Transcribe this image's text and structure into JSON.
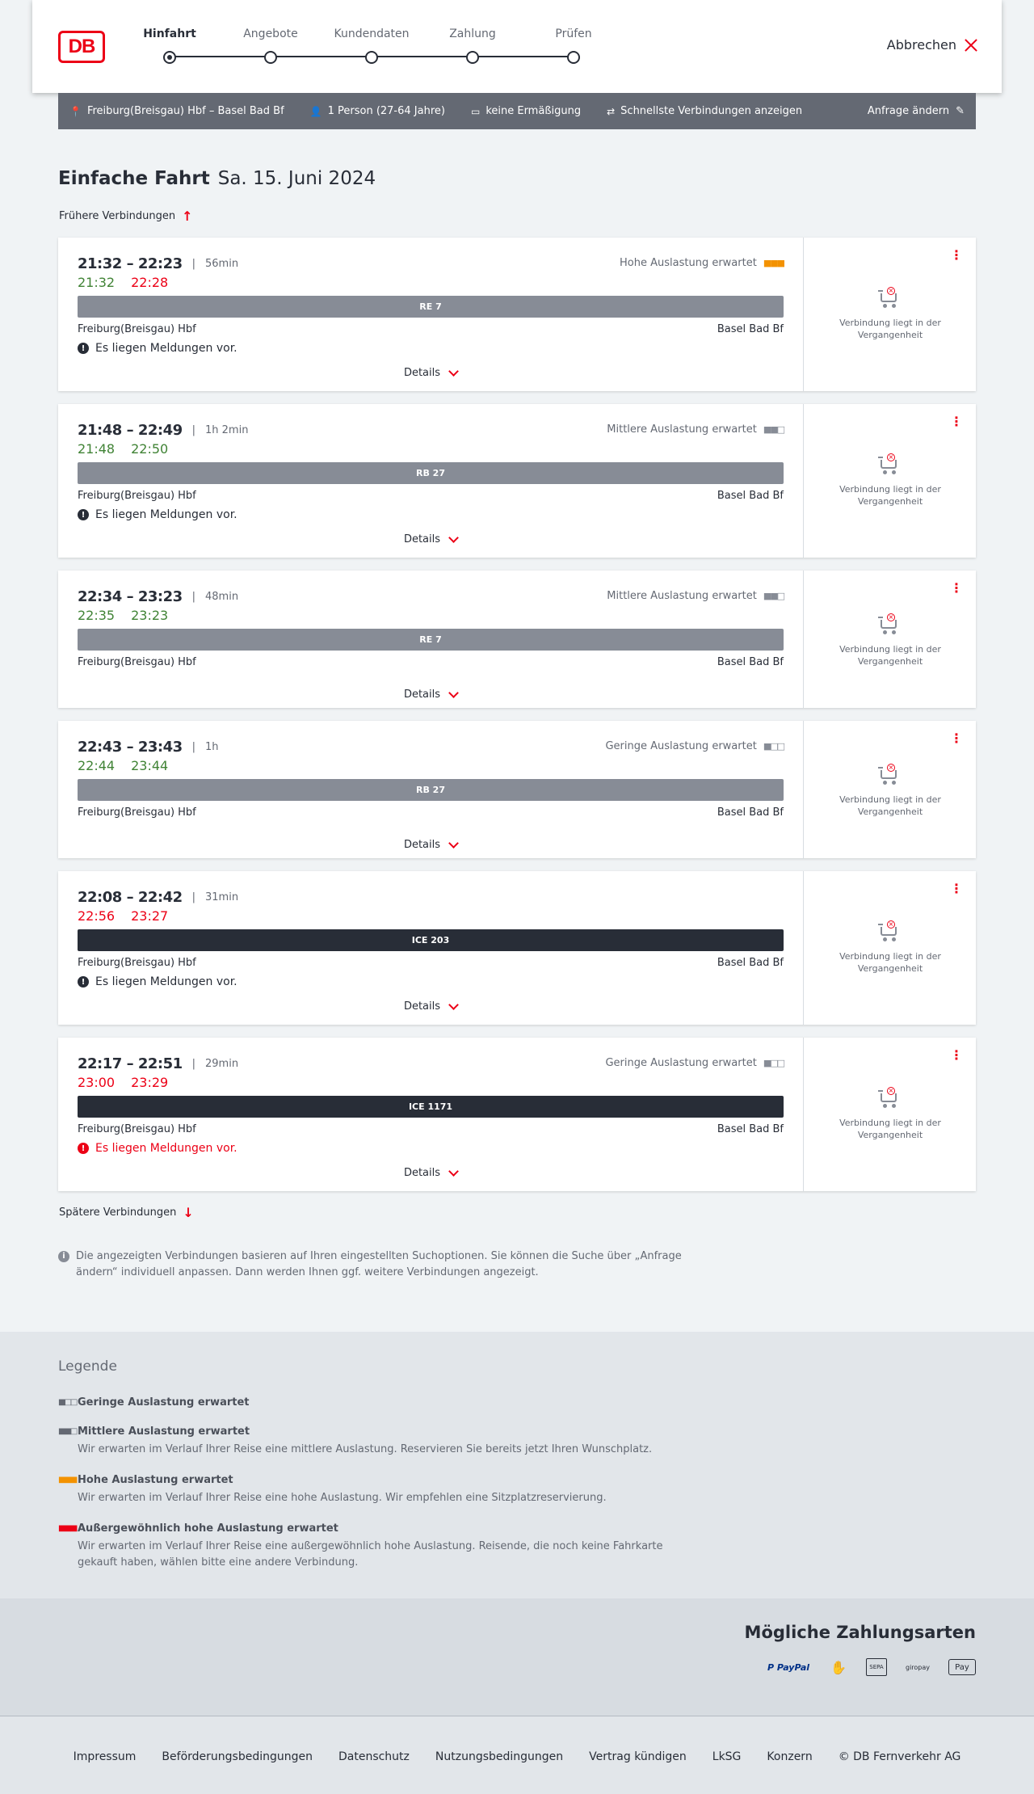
{
  "logo": "DB",
  "stepper": [
    {
      "label": "Hinfahrt",
      "active": true
    },
    {
      "label": "Angebote"
    },
    {
      "label": "Kundendaten"
    },
    {
      "label": "Zahlung"
    },
    {
      "label": "Prüfen"
    }
  ],
  "cancel_label": "Abbrechen",
  "search": {
    "route": "Freiburg(Breisgau) Hbf – Basel Bad Bf",
    "persons": "1 Person (27-64 Jahre)",
    "discount": "keine Ermäßigung",
    "fastest": "Schnellste Verbindungen anzeigen",
    "edit": "Anfrage ändern"
  },
  "title": {
    "type": "Einfache Fahrt",
    "date": "Sa. 15. Juni 2024"
  },
  "earlier_label": "Frühere Verbindungen",
  "later_label": "Spätere Verbindungen",
  "connections": [
    {
      "times": "21:32 – 22:23",
      "duration": "56min",
      "rt_dep": "21:32",
      "rt_arr": "22:28",
      "rt_dep_status": "ok",
      "rt_arr_status": "late",
      "load": "Hohe Auslastung erwartet",
      "load_level": "high",
      "train": "RE 7",
      "train_type": "regional",
      "from": "Freiburg(Breisgau) Hbf",
      "to": "Basel Bad Bf",
      "message": "Es liegen Meldungen vor.",
      "message_red": false,
      "details": "Details",
      "side_text": "Verbindung liegt in der Vergangenheit"
    },
    {
      "times": "21:48 – 22:49",
      "duration": "1h 2min",
      "rt_dep": "21:48",
      "rt_arr": "22:50",
      "rt_dep_status": "ok",
      "rt_arr_status": "ok",
      "load": "Mittlere Auslastung erwartet",
      "load_level": "medium",
      "train": "RB 27",
      "train_type": "regional",
      "from": "Freiburg(Breisgau) Hbf",
      "to": "Basel Bad Bf",
      "message": "Es liegen Meldungen vor.",
      "message_red": false,
      "details": "Details",
      "side_text": "Verbindung liegt in der Vergangenheit"
    },
    {
      "times": "22:34 – 23:23",
      "duration": "48min",
      "rt_dep": "22:35",
      "rt_arr": "23:23",
      "rt_dep_status": "ok",
      "rt_arr_status": "ok",
      "load": "Mittlere Auslastung erwartet",
      "load_level": "medium",
      "train": "RE 7",
      "train_type": "regional",
      "from": "Freiburg(Breisgau) Hbf",
      "to": "Basel Bad Bf",
      "message": "",
      "message_red": false,
      "details": "Details",
      "side_text": "Verbindung liegt in der Vergangenheit"
    },
    {
      "times": "22:43 – 23:43",
      "duration": "1h",
      "rt_dep": "22:44",
      "rt_arr": "23:44",
      "rt_dep_status": "ok",
      "rt_arr_status": "ok",
      "load": "Geringe Auslastung erwartet",
      "load_level": "low",
      "train": "RB 27",
      "train_type": "regional",
      "from": "Freiburg(Breisgau) Hbf",
      "to": "Basel Bad Bf",
      "message": "",
      "message_red": false,
      "details": "Details",
      "side_text": "Verbindung liegt in der Vergangenheit"
    },
    {
      "times": "22:08 – 22:42",
      "duration": "31min",
      "rt_dep": "22:56",
      "rt_arr": "23:27",
      "rt_dep_status": "late",
      "rt_arr_status": "late",
      "load": "",
      "load_level": "",
      "train": "ICE 203",
      "train_type": "ice",
      "from": "Freiburg(Breisgau) Hbf",
      "to": "Basel Bad Bf",
      "message": "Es liegen Meldungen vor.",
      "message_red": false,
      "details": "Details",
      "side_text": "Verbindung liegt in der Vergangenheit"
    },
    {
      "times": "22:17 – 22:51",
      "duration": "29min",
      "rt_dep": "23:00",
      "rt_arr": "23:29",
      "rt_dep_status": "late",
      "rt_arr_status": "late",
      "load": "Geringe Auslastung erwartet",
      "load_level": "low",
      "train": "ICE 1171",
      "train_type": "ice",
      "from": "Freiburg(Breisgau) Hbf",
      "to": "Basel Bad Bf",
      "message": "Es liegen Meldungen vor.",
      "message_red": true,
      "details": "Details",
      "side_text": "Verbindung liegt in der Vergangenheit"
    }
  ],
  "info_text": "Die angezeigten Verbindungen basieren auf Ihren eingestellten Suchoptionen. Sie können die Suche über „Anfrage ändern“ individuell anpassen. Dann werden Ihnen ggf. weitere Verbindungen angezeigt.",
  "legend": {
    "title": "Legende",
    "items": [
      {
        "title": "Geringe Auslastung erwartet",
        "desc": "",
        "level": "low"
      },
      {
        "title": "Mittlere Auslastung erwartet",
        "desc": "Wir erwarten im Verlauf Ihrer Reise eine mittlere Auslastung. Reservieren Sie bereits jetzt Ihren Wunschplatz.",
        "level": "medium"
      },
      {
        "title": "Hohe Auslastung erwartet",
        "desc": "Wir erwarten im Verlauf Ihrer Reise eine hohe Auslastung. Wir empfehlen eine Sitzplatzreservierung.",
        "level": "high"
      },
      {
        "title": "Außergewöhnlich hohe Auslastung erwartet",
        "desc": "Wir erwarten im Verlauf Ihrer Reise eine außergewöhnlich hohe Auslastung. Reisende, die noch keine Fahrkarte gekauft haben, wählen bitte eine andere Verbindung.",
        "level": "very-high"
      }
    ]
  },
  "payment": {
    "title": "Mögliche Zahlungsarten",
    "methods": [
      {
        "name": "paypal-icon",
        "label": "P PayPal"
      },
      {
        "name": "hand-payment-icon",
        "label": "✋"
      },
      {
        "name": "sepa-icon",
        "label": "SEPA"
      },
      {
        "name": "giropay-icon",
        "label": "giropay"
      },
      {
        "name": "apple-pay-icon",
        "label": "Pay"
      }
    ]
  },
  "footer": [
    "Impressum",
    "Beförderungsbedingungen",
    "Datenschutz",
    "Nutzungsbedingungen",
    "Vertrag kündigen",
    "LkSG",
    "Konzern",
    "© DB Fernverkehr AG"
  ],
  "colors": {
    "db_red": "#ec0016",
    "on_time": "#408335",
    "high_load": "#f39200",
    "regional_train": "#878c96",
    "ice_train": "#282d37"
  }
}
